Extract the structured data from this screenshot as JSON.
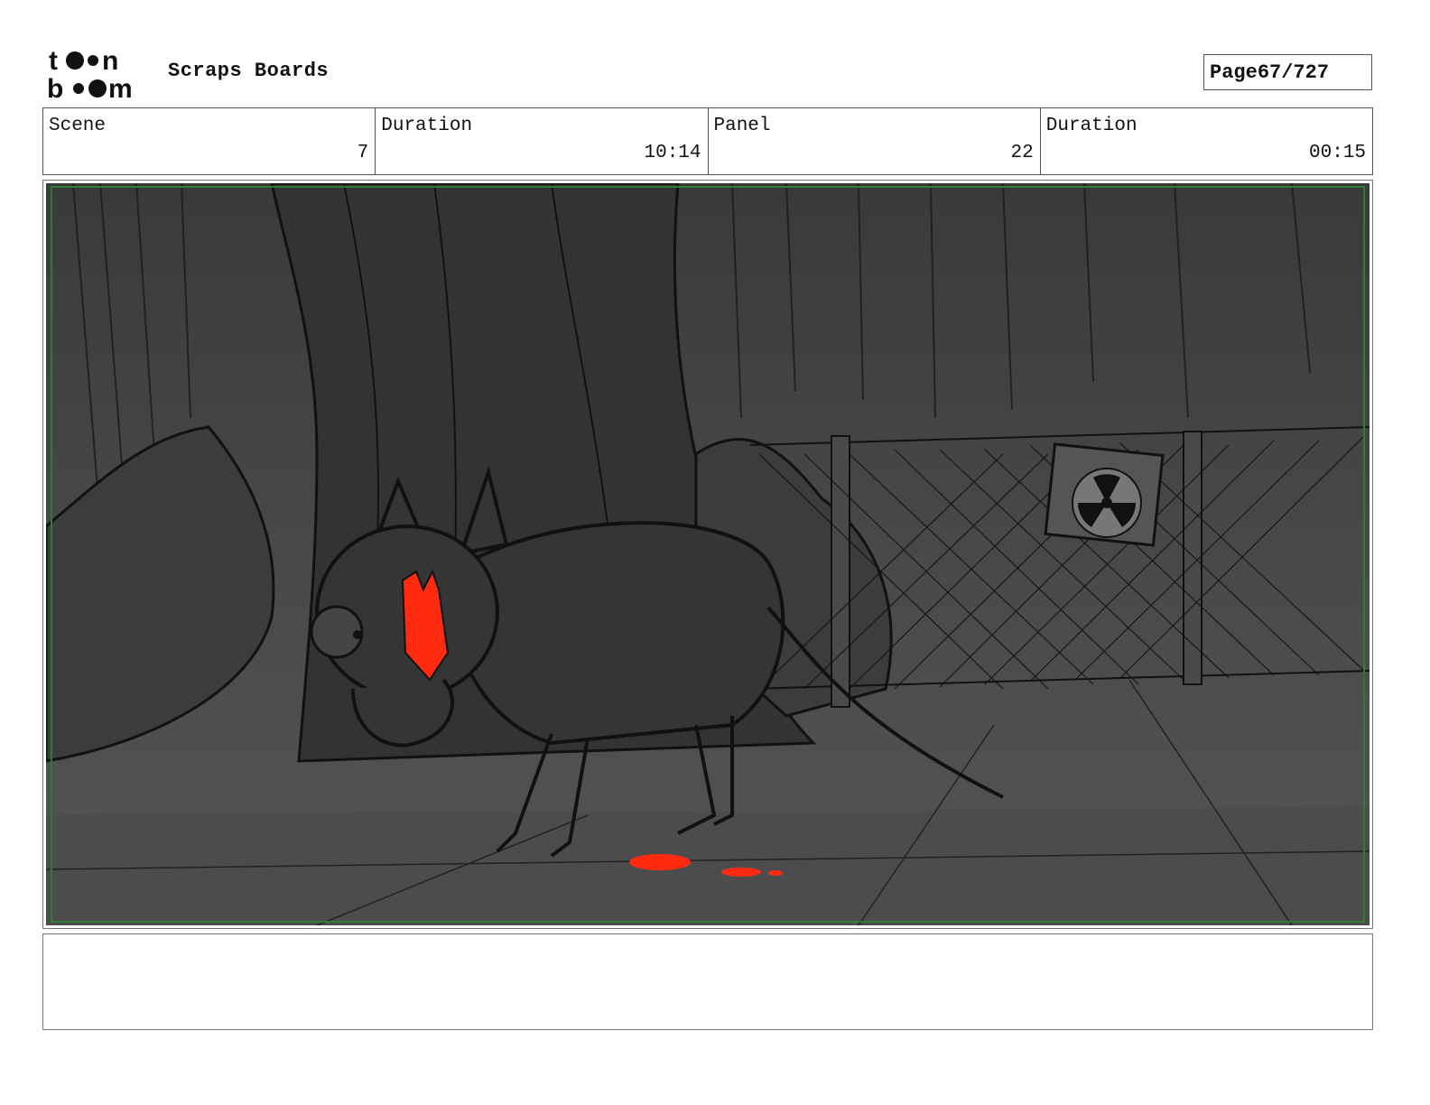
{
  "header": {
    "logo_text": "toon boom",
    "project_title": "Scraps Boards",
    "page_label": "Page",
    "page_number": "67/727"
  },
  "info": {
    "scene_label": "Scene",
    "scene_value": "7",
    "scene_duration_label": "Duration",
    "scene_duration_value": "10:14",
    "panel_label": "Panel",
    "panel_value": "22",
    "panel_duration_label": "Duration",
    "panel_duration_value": "00:15"
  },
  "panel": {
    "image_subject": "storyboard-sketch",
    "colors": {
      "background": "#4a4a4a",
      "line": "#111111",
      "accent_red": "#ff2a10",
      "safe_frame": "#2e7d32"
    }
  },
  "notes": {
    "text": ""
  }
}
